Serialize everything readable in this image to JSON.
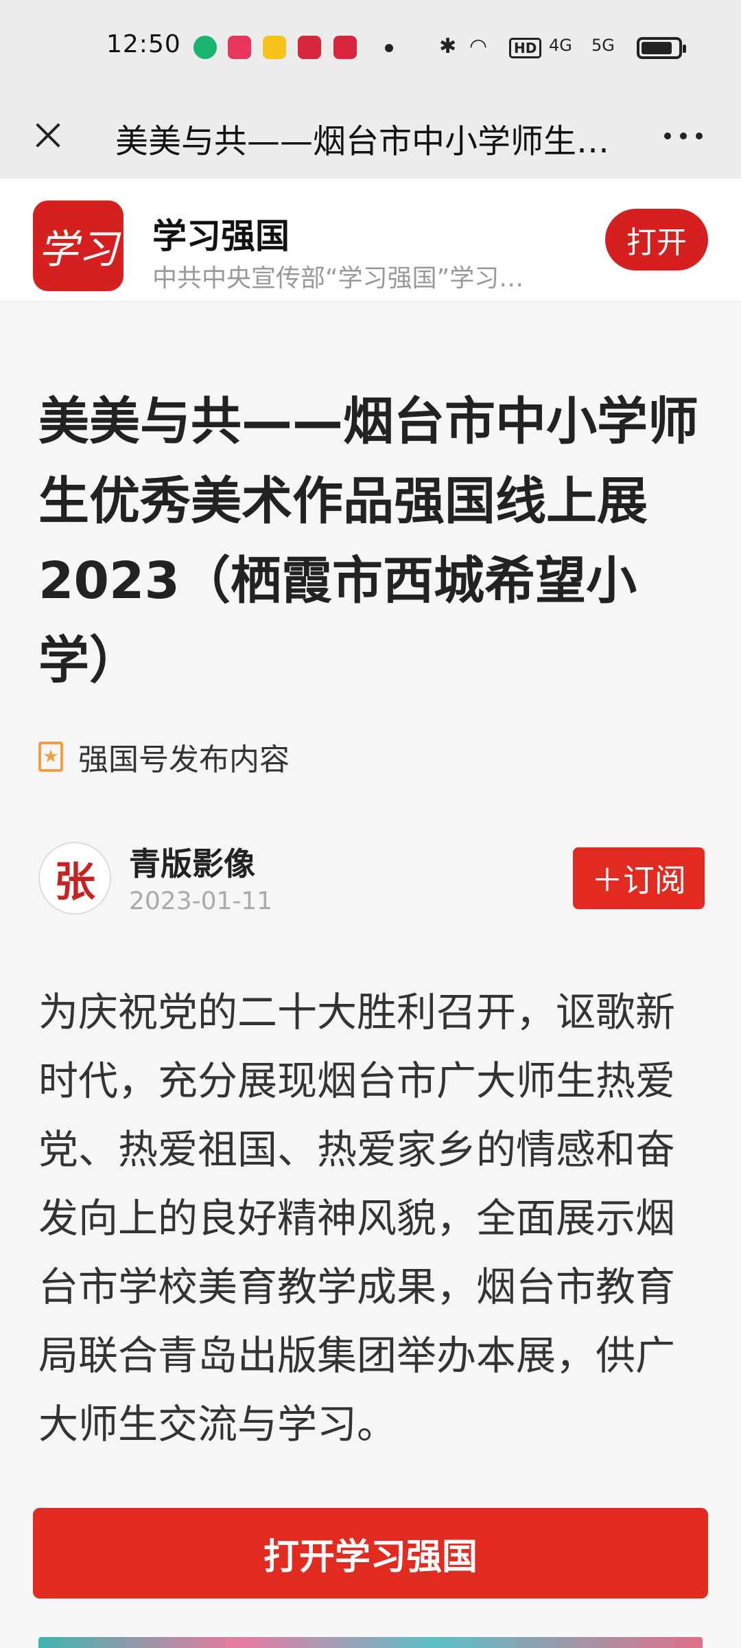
{
  "status_bar": {
    "time": "12:50",
    "hd_label": "HD",
    "signal1_label": "4G",
    "signal2_label": "5G"
  },
  "nav": {
    "title": "美美与共——烟台市中小学师生…"
  },
  "app_banner": {
    "name": "学习强国",
    "description": "中共中央宣传部“学习强国”学习…",
    "open_label": "打开",
    "logo_text": "学习"
  },
  "article": {
    "title": "美美与共——烟台市中小学师生优秀美术作品强国线上展2023（栖霞市西城希望小学）",
    "source_label": "强国号发布内容",
    "author": {
      "name": "青版影像",
      "date": "2023-01-11",
      "avatar_text": "张"
    },
    "subscribe_label": "＋订阅",
    "body": "为庆祝党的二十大胜利召开，讴歌新时代，充分展现烟台市广大师生热爱党、热爱祖国、热爱家乡的情感和奋发向上的良好精神风貌，全面展示烟台市学校美育教学成果，烟台市教育局联合青岛出版集团举办本展，供广大师生交流与学习。"
  },
  "cta": {
    "label": "打开学习强国"
  },
  "colors": {
    "brand_red": "#e22b20",
    "banner_red": "#d61f1f",
    "star_orange": "#f0a040"
  }
}
